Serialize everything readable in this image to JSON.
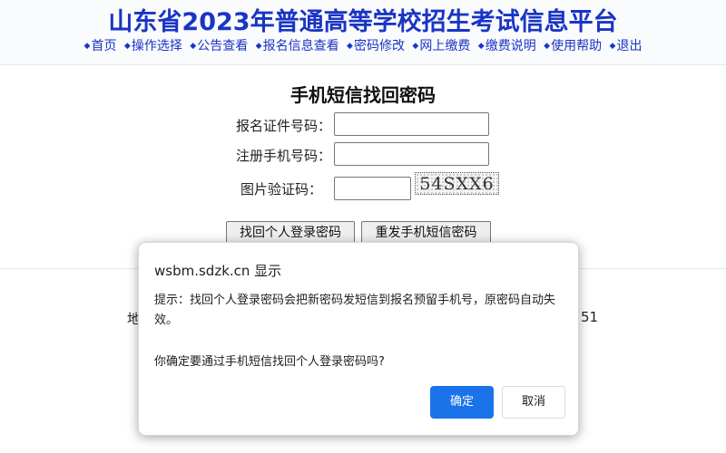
{
  "header": {
    "title": "山东省2023年普通高等学校招生考试信息平台",
    "nav": [
      {
        "label": "首页",
        "icon": "diamond-bullet-icon"
      },
      {
        "label": "操作选择",
        "icon": "diamond-bullet-icon"
      },
      {
        "label": "公告查看",
        "icon": "diamond-bullet-icon"
      },
      {
        "label": "报名信息查看",
        "icon": "diamond-bullet-icon"
      },
      {
        "label": "密码修改",
        "icon": "diamond-bullet-icon"
      },
      {
        "label": "网上缴费",
        "icon": "diamond-bullet-icon"
      },
      {
        "label": "缴费说明",
        "icon": "diamond-bullet-icon"
      },
      {
        "label": "使用帮助",
        "icon": "diamond-bullet-icon"
      },
      {
        "label": "退出",
        "icon": "diamond-bullet-icon"
      }
    ],
    "title_color": "#1a35c4"
  },
  "form": {
    "title": "手机短信找回密码",
    "id_label": "报名证件号码：",
    "id_value": "",
    "phone_label": "注册手机号码：",
    "phone_value": "",
    "captcha_label": "图片验证码：",
    "captcha_value": "",
    "captcha_image_text": "54SXX6",
    "retrieve_button": "找回个人登录密码",
    "resend_button": "重发手机短信密码"
  },
  "footer": {
    "left_fragment": "地",
    "right_fragment": "51"
  },
  "dialog": {
    "title": "wsbm.sdzk.cn 显示",
    "message": "提示：找回个人登录密码会把新密码发短信到报名预留手机号，原密码自动失效。",
    "confirm_text": "你确定要通过手机短信找回个人登录密码吗?",
    "ok_label": "确定",
    "cancel_label": "取消",
    "ok_color": "#1a73e8"
  }
}
